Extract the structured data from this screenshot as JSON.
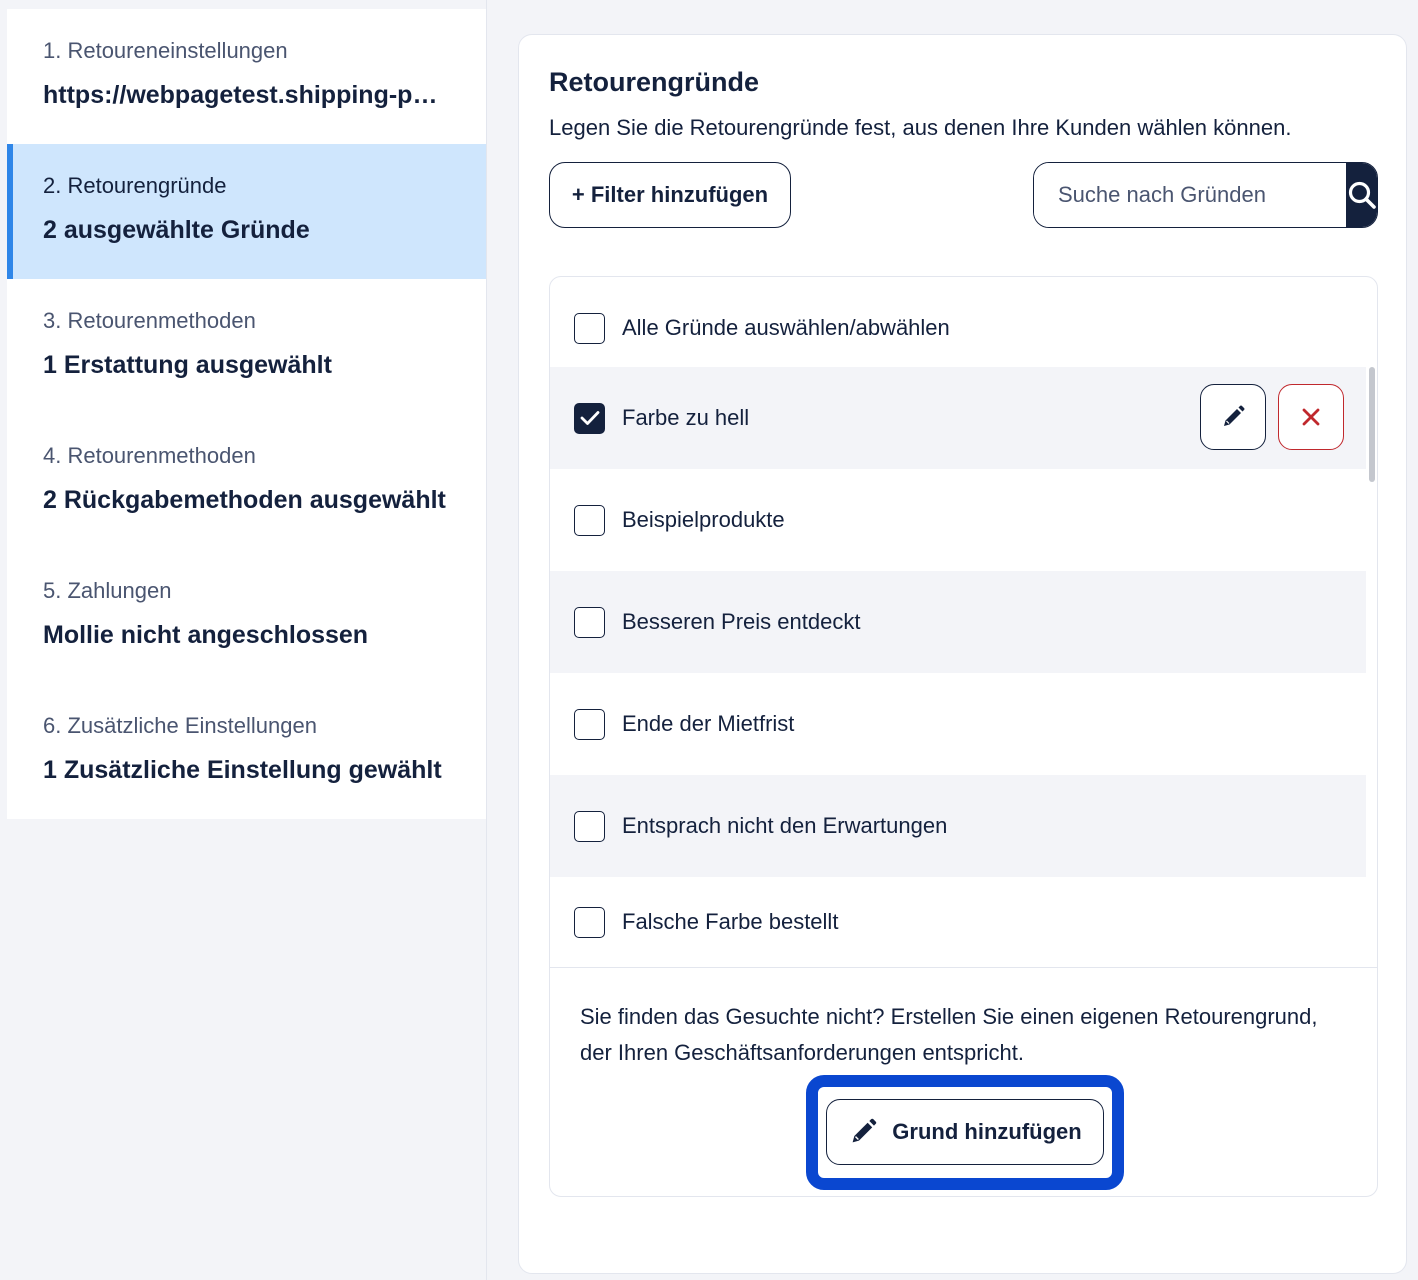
{
  "sidebar": {
    "steps": [
      {
        "title": "1. Retoureneinstellungen",
        "value": "https://webpagetest.shipping-po…",
        "active": false
      },
      {
        "title": "2. Retourengründe",
        "value": "2 ausgewählte Gründe",
        "active": true
      },
      {
        "title": "3. Retourenmethoden",
        "value": "1 Erstattung ausgewählt",
        "active": false
      },
      {
        "title": "4. Retourenmethoden",
        "value": "2 Rückgabemethoden ausgewählt",
        "active": false
      },
      {
        "title": "5. Zahlungen",
        "value": "Mollie nicht angeschlossen",
        "active": false
      },
      {
        "title": "6. Zusätzliche Einstellungen",
        "value": "1 Zusätzliche Einstellung gewählt",
        "active": false
      }
    ]
  },
  "main": {
    "title": "Retourengründe",
    "subtitle": "Legen Sie die Retourengründe fest, aus denen Ihre Kunden wählen können.",
    "filter_button": "+ Filter hinzufügen",
    "search": {
      "placeholder": "Suche nach Gründen"
    },
    "list": {
      "select_all": "Alle Gründe auswählen/abwählen",
      "items": [
        {
          "label": "Farbe zu hell",
          "checked": true
        },
        {
          "label": "Beispielprodukte",
          "checked": false
        },
        {
          "label": "Besseren Preis entdeckt",
          "checked": false
        },
        {
          "label": "Ende der Mietfrist",
          "checked": false
        },
        {
          "label": "Entsprach nicht den Erwartungen",
          "checked": false
        },
        {
          "label": "Falsche Farbe bestellt",
          "checked": false
        }
      ]
    },
    "footer_text": "Sie finden das Gesuchte nicht? Erstellen Sie einen eigenen Retourengrund, der Ihren Geschäftsanforderungen entspricht.",
    "add_button": "Grund hinzufügen"
  },
  "colors": {
    "primary": "#14213d",
    "active_bg": "#cfe6fd",
    "active_indicator": "#2f86e8",
    "delete": "#c0282d",
    "highlight": "#0a47d0"
  }
}
